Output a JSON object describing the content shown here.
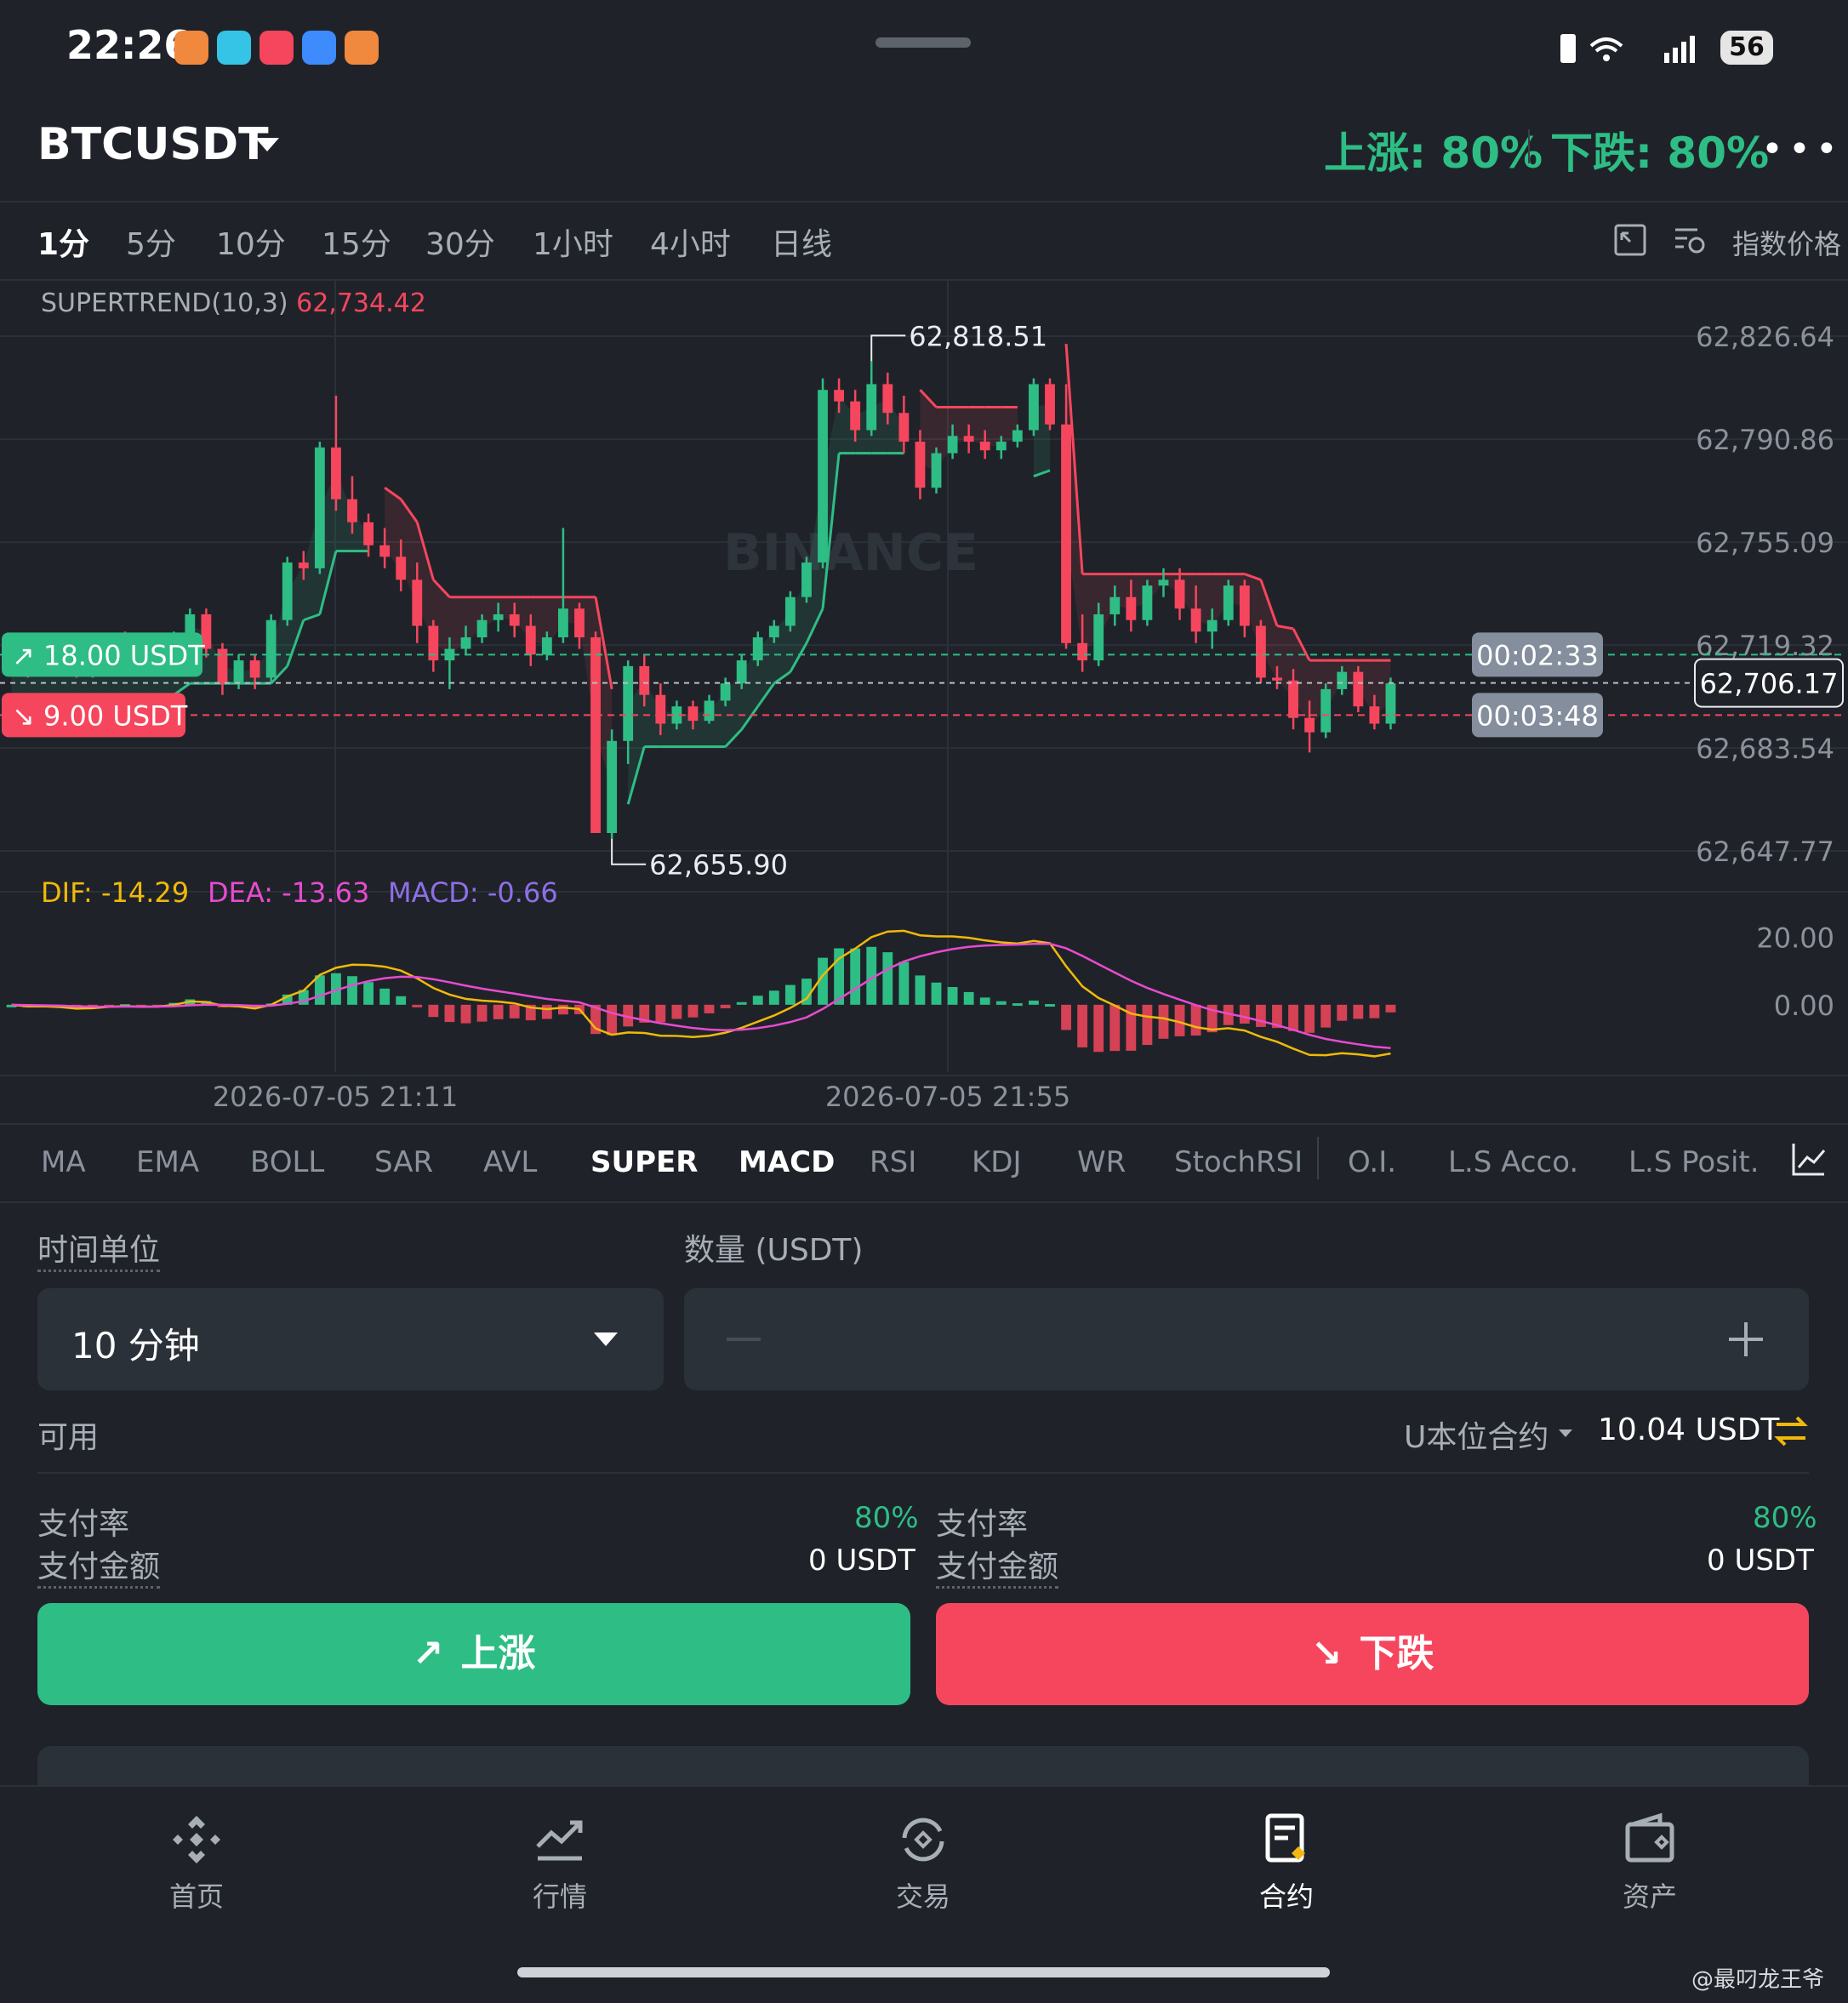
{
  "status_bar": {
    "time": "22:26",
    "battery": "56",
    "app_icons": [
      "#f0883e",
      "#35c3e6",
      "#f5465d",
      "#3d8bfd",
      "#f0883e"
    ]
  },
  "header": {
    "symbol": "BTCUSDT",
    "up_rate": "上涨: 80%",
    "down_rate": "下跌: 80%"
  },
  "timeframes": [
    "1分",
    "5分",
    "10分",
    "15分",
    "30分",
    "1小时",
    "4小时",
    "日线"
  ],
  "active_timeframe": "1分",
  "index_price_label": "指数价格",
  "chart_data": [
    {
      "type": "candlestick",
      "indicator_label": "SUPERTREND(10,3)",
      "indicator_value": "62,734.42",
      "watermark": "BINANCE",
      "y_ticks": [
        "62,826.64",
        "62,790.86",
        "62,755.09",
        "62,719.32",
        "62,683.54",
        "62,647.77"
      ],
      "y_tick_values": [
        62826.64,
        62790.86,
        62755.09,
        62719.32,
        62683.54,
        62647.77
      ],
      "ylim": [
        62633,
        62840
      ],
      "x_ticks": [
        "2026-07-05 21:11",
        "2026-07-05 21:55"
      ],
      "last_price": "62,706.17",
      "last_price_value": 62706.17,
      "high_label": "62,818.51",
      "low_label": "62,655.90",
      "up_position": {
        "label": "18.00 USDT",
        "price": 62716,
        "timer": "00:02:33"
      },
      "down_position": {
        "label": "9.00 USDT",
        "price": 62695,
        "timer": "00:03:48"
      },
      "candles": [
        [
          62720,
          62722,
          62712,
          62718
        ],
        [
          62718,
          62720,
          62708,
          62712
        ],
        [
          62712,
          62719,
          62710,
          62717
        ],
        [
          62717,
          62720,
          62712,
          62714
        ],
        [
          62714,
          62716,
          62708,
          62710
        ],
        [
          62710,
          62718,
          62708,
          62716
        ],
        [
          62716,
          62722,
          62714,
          62720
        ],
        [
          62720,
          62724,
          62716,
          62718
        ],
        [
          62718,
          62720,
          62712,
          62714
        ],
        [
          62714,
          62718,
          62710,
          62716
        ],
        [
          62716,
          62724,
          62714,
          62722
        ],
        [
          62722,
          62732,
          62720,
          62730
        ],
        [
          62730,
          62732,
          62715,
          62718
        ],
        [
          62718,
          62720,
          62702,
          62706
        ],
        [
          62706,
          62716,
          62704,
          62714
        ],
        [
          62714,
          62716,
          62704,
          62708
        ],
        [
          62708,
          62730,
          62706,
          62728
        ],
        [
          62728,
          62750,
          62726,
          62748
        ],
        [
          62748,
          62752,
          62742,
          62746
        ],
        [
          62746,
          62790,
          62744,
          62788
        ],
        [
          62788,
          62806,
          62766,
          62770
        ],
        [
          62770,
          62778,
          62758,
          62762
        ],
        [
          62762,
          62765,
          62750,
          62754
        ],
        [
          62754,
          62760,
          62746,
          62750
        ],
        [
          62750,
          62756,
          62738,
          62742
        ],
        [
          62742,
          62748,
          62720,
          62726
        ],
        [
          62726,
          62728,
          62710,
          62714
        ],
        [
          62714,
          62722,
          62704,
          62718
        ],
        [
          62718,
          62726,
          62716,
          62722
        ],
        [
          62722,
          62730,
          62720,
          62728
        ],
        [
          62728,
          62734,
          62724,
          62730
        ],
        [
          62730,
          62734,
          62722,
          62726
        ],
        [
          62726,
          62730,
          62712,
          62716
        ],
        [
          62716,
          62724,
          62714,
          62722
        ],
        [
          62722,
          62760,
          62720,
          62732
        ],
        [
          62732,
          62734,
          62718,
          62722
        ],
        [
          62722,
          62724,
          62680,
          62654
        ],
        [
          62654,
          62690,
          62652,
          62686
        ],
        [
          62686,
          62714,
          62678,
          62712
        ],
        [
          62712,
          62716,
          62698,
          62702
        ],
        [
          62702,
          62706,
          62688,
          62692
        ],
        [
          62692,
          62700,
          62690,
          62698
        ],
        [
          62698,
          62700,
          62690,
          62693
        ],
        [
          62693,
          62702,
          62692,
          62700
        ],
        [
          62700,
          62708,
          62698,
          62706
        ],
        [
          62706,
          62716,
          62704,
          62714
        ],
        [
          62714,
          62724,
          62712,
          62722
        ],
        [
          62722,
          62728,
          62720,
          62726
        ],
        [
          62726,
          62738,
          62724,
          62736
        ],
        [
          62736,
          62750,
          62734,
          62748
        ],
        [
          62748,
          62812,
          62746,
          62808
        ],
        [
          62808,
          62812,
          62800,
          62804
        ],
        [
          62804,
          62808,
          62790,
          62794
        ],
        [
          62794,
          62818,
          62792,
          62810
        ],
        [
          62810,
          62814,
          62796,
          62800
        ],
        [
          62800,
          62806,
          62786,
          62790
        ],
        [
          62790,
          62794,
          62770,
          62774
        ],
        [
          62774,
          62788,
          62772,
          62786
        ],
        [
          62786,
          62796,
          62784,
          62792
        ],
        [
          62792,
          62796,
          62786,
          62790
        ],
        [
          62790,
          62794,
          62784,
          62787
        ],
        [
          62787,
          62792,
          62784,
          62790
        ],
        [
          62790,
          62796,
          62788,
          62794
        ],
        [
          62794,
          62812,
          62792,
          62810
        ],
        [
          62810,
          62812,
          62794,
          62796
        ],
        [
          62796,
          62810,
          62718,
          62720
        ],
        [
          62720,
          62730,
          62710,
          62714
        ],
        [
          62714,
          62734,
          62712,
          62730
        ],
        [
          62730,
          62740,
          62726,
          62736
        ],
        [
          62736,
          62742,
          62724,
          62728
        ],
        [
          62728,
          62742,
          62726,
          62740
        ],
        [
          62740,
          62746,
          62736,
          62742
        ],
        [
          62742,
          62746,
          62728,
          62732
        ],
        [
          62732,
          62740,
          62720,
          62724
        ],
        [
          62724,
          62732,
          62718,
          62728
        ],
        [
          62728,
          62742,
          62726,
          62740
        ],
        [
          62740,
          62742,
          62722,
          62726
        ],
        [
          62726,
          62728,
          62706,
          62708
        ],
        [
          62708,
          62712,
          62704,
          62707
        ],
        [
          62707,
          62711,
          62690,
          62694
        ],
        [
          62694,
          62700,
          62682,
          62689
        ],
        [
          62689,
          62706,
          62687,
          62704
        ],
        [
          62704,
          62712,
          62702,
          62710
        ],
        [
          62710,
          62712,
          62696,
          62698
        ],
        [
          62698,
          62702,
          62690,
          62692
        ],
        [
          62692,
          62708,
          62690,
          62706
        ]
      ]
    },
    {
      "type": "line",
      "indicator": "MACD",
      "dif_label": "DIF: -14.29",
      "dea_label": "DEA: -13.63",
      "macd_label": "MACD: -0.66",
      "y_ticks": [
        "20.00",
        "0.00"
      ],
      "y_tick_values": [
        20,
        0
      ],
      "ylim": [
        -20,
        28
      ]
    }
  ],
  "indicators": [
    "MA",
    "EMA",
    "BOLL",
    "SAR",
    "AVL",
    "SUPER",
    "MACD",
    "RSI",
    "KDJ",
    "WR",
    "StochRSI",
    "O.I.",
    "L.S Acco.",
    "L.S Posit."
  ],
  "active_indicators": [
    "SUPER",
    "MACD"
  ],
  "form": {
    "time_unit_label": "时间单位",
    "time_unit_value": "10 分钟",
    "amount_label": "数量 (USDT)",
    "available_label": "可用",
    "contract_type": "U本位合约",
    "available_value": "10.04 USDT",
    "up": {
      "rate_label": "支付率",
      "rate": "80%",
      "amount_label": "支付金额",
      "amount": "0 USDT"
    },
    "down": {
      "rate_label": "支付率",
      "rate": "80%",
      "amount_label": "支付金额",
      "amount": "0 USDT"
    },
    "up_button": "上涨",
    "down_button": "下跌"
  },
  "nav": [
    {
      "label": "首页",
      "icon": "binance-logo-icon"
    },
    {
      "label": "行情",
      "icon": "market-chart-icon"
    },
    {
      "label": "交易",
      "icon": "trade-exchange-icon"
    },
    {
      "label": "合约",
      "icon": "futures-contract-icon"
    },
    {
      "label": "资产",
      "icon": "wallet-icon"
    }
  ],
  "active_nav": "合约",
  "watermark_text": "@最叼龙王爷",
  "colors": {
    "green": "#2ebd85",
    "red": "#f6465d",
    "bg": "#1f2329",
    "dif": "#f0b90b",
    "dea": "#e84bd0",
    "macd": "#8e6fe6"
  }
}
